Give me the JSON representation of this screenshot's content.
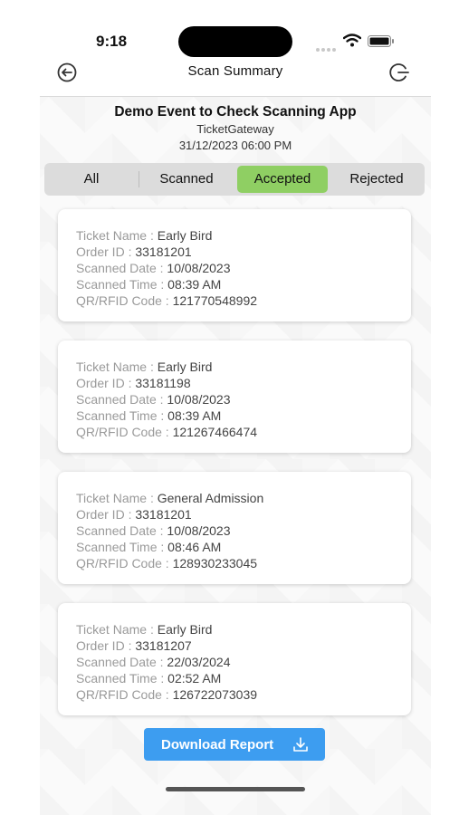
{
  "status_bar": {
    "time": "9:18"
  },
  "nav": {
    "title": "Scan Summary"
  },
  "event": {
    "title": "Demo Event to Check Scanning App",
    "organizer": "TicketGateway",
    "date": "31/12/2023 06:00 PM"
  },
  "tabs": [
    {
      "label": "All",
      "active": false
    },
    {
      "label": "Scanned",
      "active": false
    },
    {
      "label": "Accepted",
      "active": true
    },
    {
      "label": "Rejected",
      "active": false
    }
  ],
  "labels": {
    "ticket_name": "Ticket Name : ",
    "order_id": "Order ID : ",
    "scanned_date": "Scanned Date : ",
    "scanned_time": "Scanned Time : ",
    "code": "QR/RFID Code : "
  },
  "tickets": [
    {
      "ticket_name": "Early Bird",
      "order_id": "33181201",
      "scanned_date": "10/08/2023",
      "scanned_time": "08:39 AM",
      "code": "121770548992"
    },
    {
      "ticket_name": "Early Bird",
      "order_id": "33181198",
      "scanned_date": "10/08/2023",
      "scanned_time": "08:39 AM",
      "code": "121267466474"
    },
    {
      "ticket_name": "General Admission",
      "order_id": "33181201",
      "scanned_date": "10/08/2023",
      "scanned_time": "08:46 AM",
      "code": "128930233045"
    },
    {
      "ticket_name": "Early Bird",
      "order_id": "33181207",
      "scanned_date": "22/03/2024",
      "scanned_time": "02:52 AM",
      "code": "126722073039"
    }
  ],
  "download": {
    "label": "Download Report",
    "icon": "download-icon"
  },
  "colors": {
    "accent": "#3d9df0",
    "active_tab": "#8fcf63"
  }
}
